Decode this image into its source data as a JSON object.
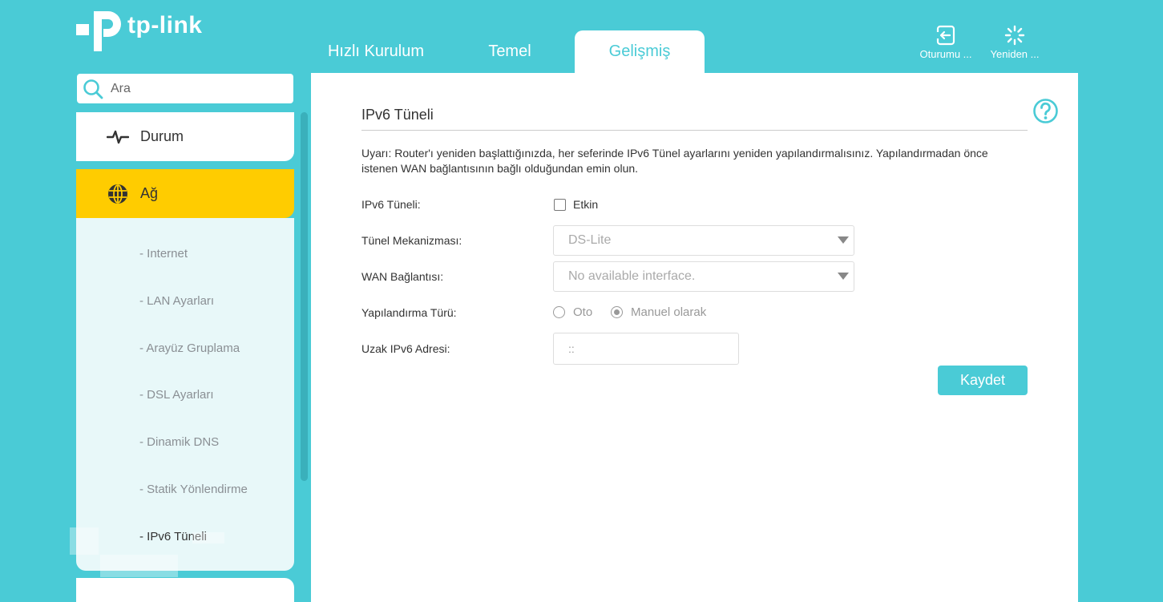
{
  "brand": {
    "logo_text": "tp-link",
    "accent_color": "#4acbd6",
    "active_color": "#ffcc00"
  },
  "tabs": [
    {
      "label": "Hızlı Kurulum"
    },
    {
      "label": "Temel"
    },
    {
      "label": "Gelişmiş",
      "active": true
    }
  ],
  "actions": {
    "logout_label": "Oturumu ...",
    "reboot_label": "Yeniden ..."
  },
  "search": {
    "placeholder": "Ara",
    "icon": "search-icon"
  },
  "sidebar": {
    "status": {
      "label": "Durum",
      "icon": "pulse-icon"
    },
    "network": {
      "label": "Ağ",
      "icon": "globe-icon",
      "active": true
    },
    "submenu": [
      {
        "label": "- Internet"
      },
      {
        "label": "- LAN Ayarları"
      },
      {
        "label": "- Arayüz Gruplama"
      },
      {
        "label": "- DSL Ayarları"
      },
      {
        "label": "- Dinamik DNS"
      },
      {
        "label": "- Statik Yönlendirme"
      },
      {
        "label": "- IPv6 Tüneli",
        "active": true
      }
    ]
  },
  "main": {
    "title": "IPv6 Tüneli",
    "warning": "Uyarı: Router'ı yeniden başlattığınızda, her seferinde IPv6 Tünel ayarlarını yeniden yapılandırmalısınız. Yapılandırmadan önce istenen WAN bağlantısının bağlı olduğundan emin olun.",
    "fields": {
      "tunnel": {
        "label": "IPv6 Tüneli:",
        "checkbox_label": "Etkin",
        "checked": false
      },
      "mechanism": {
        "label": "Tünel Mekanizması:",
        "value": "DS-Lite"
      },
      "wan": {
        "label": "WAN Bağlantısı:",
        "value": "No available interface."
      },
      "config_type": {
        "label": "Yapılandırma Türü:",
        "options": [
          "Oto",
          "Manuel olarak"
        ],
        "selected": "Manuel olarak"
      },
      "remote": {
        "label": "Uzak IPv6 Adresi:",
        "value": "::"
      }
    },
    "save_label": "Kaydet"
  }
}
